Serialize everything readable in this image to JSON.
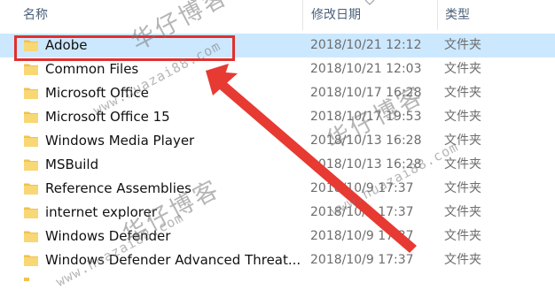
{
  "columns": {
    "name": "名称",
    "date": "修改日期",
    "type": "类型"
  },
  "rows": [
    {
      "name": "Adobe",
      "date": "2018/10/21 12:12",
      "type": "文件夹",
      "selected": true
    },
    {
      "name": "Common Files",
      "date": "2018/10/21 12:03",
      "type": "文件夹"
    },
    {
      "name": "Microsoft Office",
      "date": "2018/10/17 16:28",
      "type": "文件夹"
    },
    {
      "name": "Microsoft Office 15",
      "date": "2018/10/17 19:53",
      "type": "文件夹"
    },
    {
      "name": "Windows Media Player",
      "date": "2018/10/13 16:28",
      "type": "文件夹"
    },
    {
      "name": "MSBuild",
      "date": "2018/10/13 16:28",
      "type": "文件夹"
    },
    {
      "name": "Reference Assemblies",
      "date": "2018/10/9 17:37",
      "type": "文件夹"
    },
    {
      "name": "internet explorer",
      "date": "2018/10/9 17:37",
      "type": "文件夹"
    },
    {
      "name": "Windows Defender",
      "date": "2018/10/9 17:37",
      "type": "文件夹"
    },
    {
      "name": "Windows Defender Advanced Threat...",
      "date": "2018/10/9 17:37",
      "type": "文件夹"
    }
  ],
  "watermark": {
    "cn": "华仔博客",
    "url": "www.huazai88.com"
  },
  "colors": {
    "selection": "#cce8ff",
    "highlight": "#e0302e",
    "folder": "#f2c14e"
  }
}
